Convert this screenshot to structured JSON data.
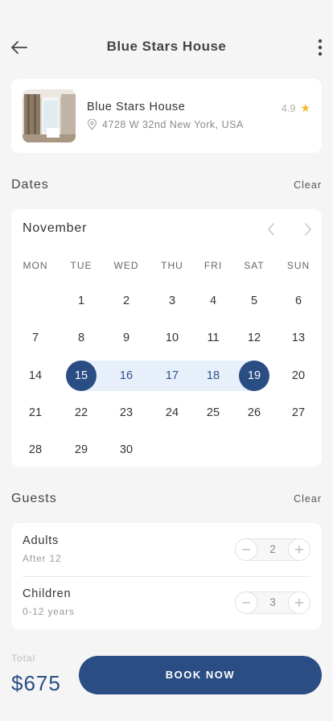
{
  "header": {
    "title": "Blue Stars House",
    "back_icon": "arrow-left-icon",
    "more_icon": "more-vertical-icon"
  },
  "hotel": {
    "name": "Blue Stars House",
    "address": "4728 W 32nd New York, USA",
    "rating": "4.9",
    "rating_icon": "star-icon",
    "star_color": "#f5b82e"
  },
  "dates": {
    "title": "Dates",
    "clear_label": "Clear",
    "month": "November",
    "weekdays": [
      "MON",
      "TUE",
      "WED",
      "THU",
      "FRI",
      "SAT",
      "SUN"
    ],
    "first_weekday_index": 1,
    "days_in_month": 30,
    "range_start": 15,
    "range_end": 19,
    "accent_color": "#2a4d84",
    "range_color": "#e7f0fa"
  },
  "guests": {
    "title": "Guests",
    "clear_label": "Clear",
    "adults": {
      "label": "Adults",
      "sub": "After 12",
      "count": "2"
    },
    "children": {
      "label": "Children",
      "sub": "0-12 years",
      "count": "3"
    }
  },
  "footer": {
    "total_label": "Total",
    "total_value": "$675",
    "book_label": "BOOK NOW"
  }
}
